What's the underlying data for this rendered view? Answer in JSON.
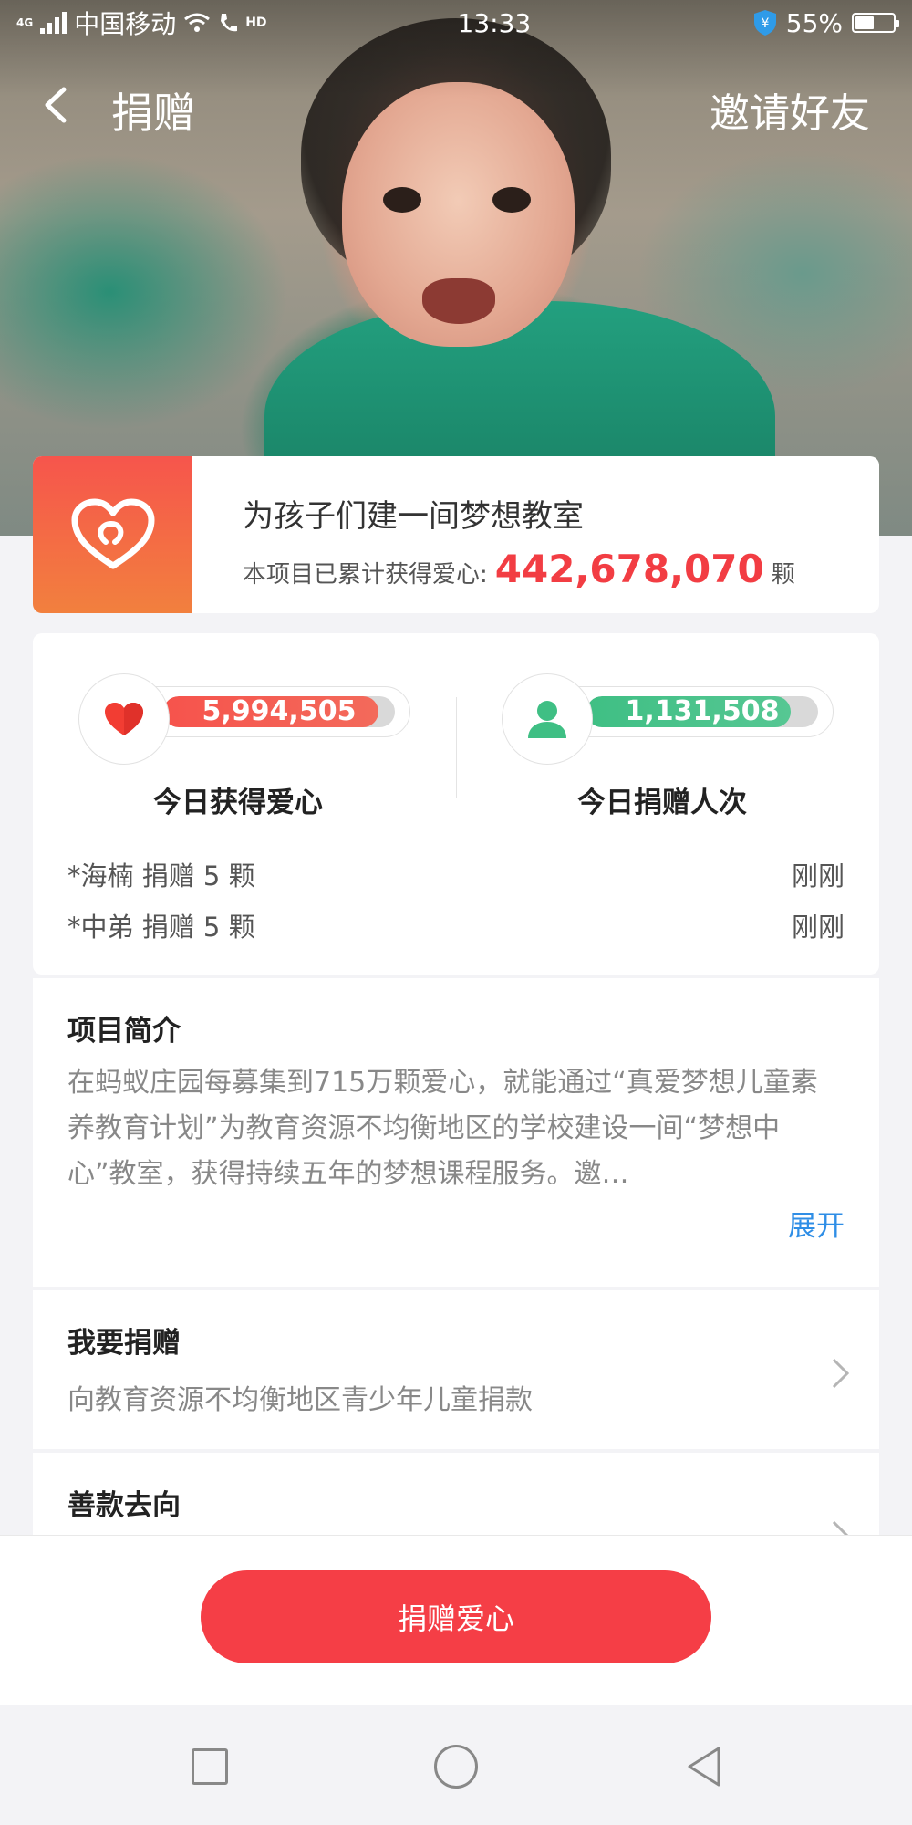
{
  "status_bar": {
    "network": "4G",
    "carrier": "中国移动",
    "hd": "HD",
    "time": "13:33",
    "battery": "55%",
    "battery_level": 0.55
  },
  "nav": {
    "title": "捐赠",
    "invite": "邀请好友"
  },
  "project": {
    "title": "为孩子们建一间梦想教室",
    "stat_label": "本项目已累计获得爱心:",
    "stat_value": "442,678,070",
    "stat_unit": "颗"
  },
  "stats": {
    "hearts_value": "5,994,505",
    "hearts_fill": 0.93,
    "hearts_label": "今日获得爱心",
    "donors_value": "1,131,508",
    "donors_fill": 0.88,
    "donors_label": "今日捐赠人次",
    "donations": [
      {
        "text": "*海楠 捐赠 5 颗",
        "time": "刚刚"
      },
      {
        "text": "*中弟 捐赠 5 颗",
        "time": "刚刚"
      }
    ]
  },
  "intro": {
    "title": "项目简介",
    "text": "在蚂蚁庄园每募集到715万颗爱心，就能通过“真爱梦想儿童素养教育计划”为教育资源不均衡地区的学校建设一间“梦想中心”教室，获得持续五年的梦想课程服务。邀…",
    "expand": "展开"
  },
  "donate_row": {
    "title": "我要捐赠",
    "subtitle": "向教育资源不均衡地区青少年儿童捐款"
  },
  "flow_row": {
    "title": "善款去向"
  },
  "action": {
    "donate_button": "捐赠爱心"
  },
  "colors": {
    "accent_red": "#f53e46",
    "link_blue": "#2f8ee6",
    "green": "#3fbf84"
  }
}
